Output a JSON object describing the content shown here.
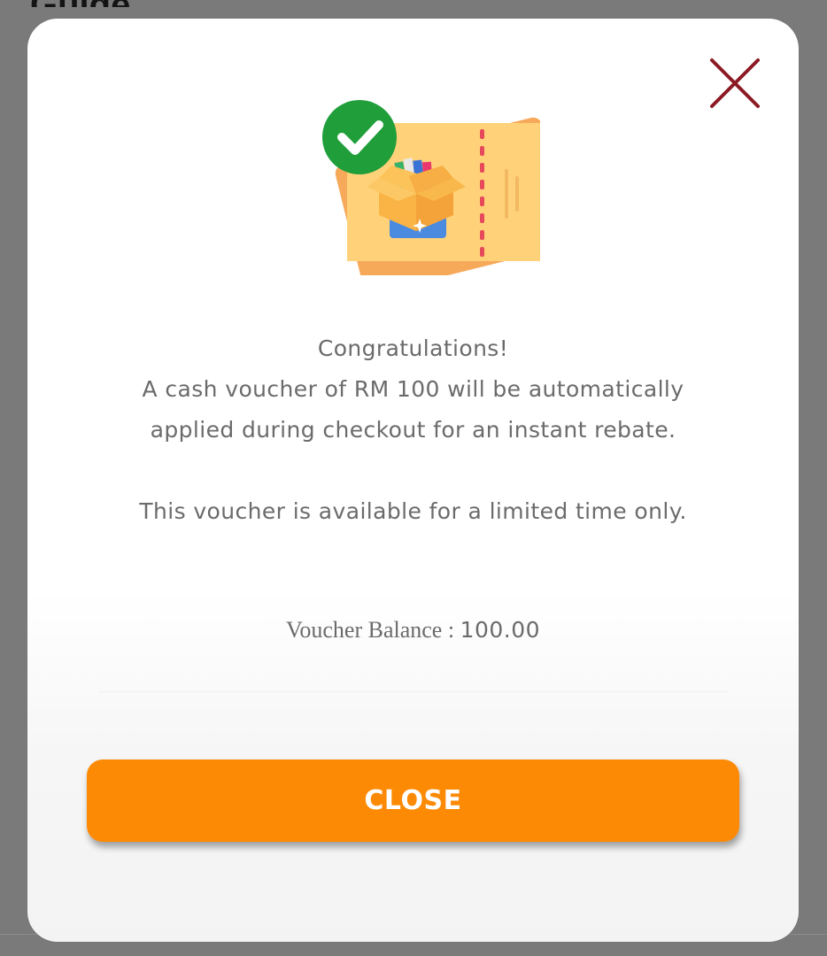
{
  "background": {
    "title": "Guide"
  },
  "modal": {
    "close_icon": "close-x-icon",
    "illustration": "voucher-ticket-gift-box-with-check-icon",
    "message": {
      "line1": "Congratulations!",
      "line2": "A cash voucher of RM 100 will be automatically",
      "line3": "applied during checkout for an instant rebate.",
      "line4": "This voucher is available for a limited time only."
    },
    "balance": {
      "label": "Voucher Balance : ",
      "value": "100.00"
    },
    "close_button": {
      "label": "CLOSE"
    }
  },
  "colors": {
    "accent": "#fd8a05",
    "close_x": "#8b1a24",
    "check_green": "#1f9e3a",
    "ticket": "#ffd27a",
    "text": "#6b6b6b"
  }
}
